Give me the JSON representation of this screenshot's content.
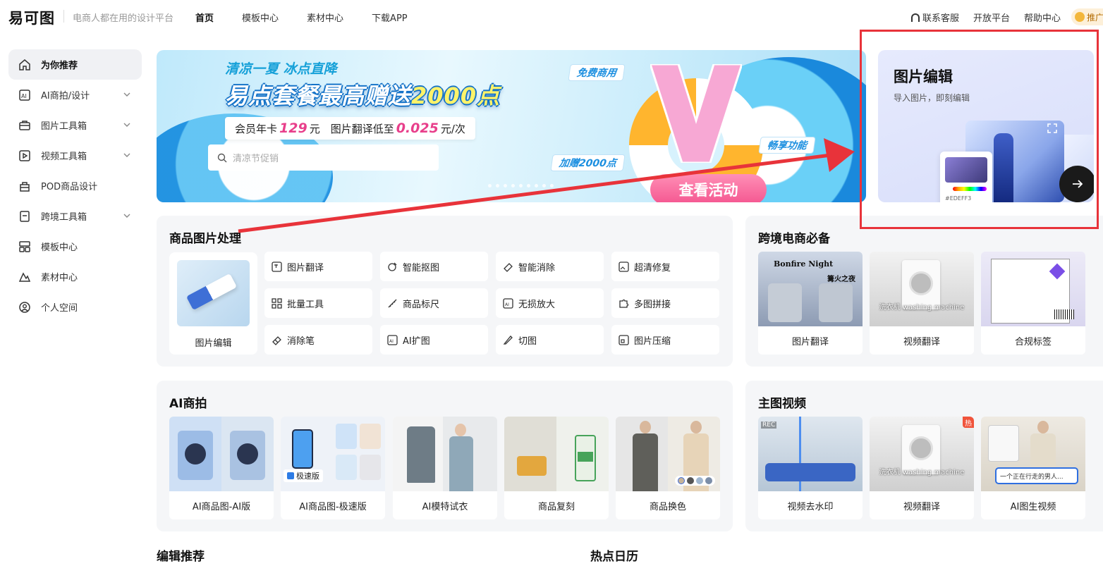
{
  "header": {
    "logo": "易可图",
    "tagline": "电商人都在用的设计平台",
    "nav": [
      "首页",
      "模板中心",
      "素材中心",
      "下载APP"
    ],
    "right_links": [
      "联系客服",
      "开放平台",
      "帮助中心"
    ],
    "promo": "推广"
  },
  "sidebar": {
    "items": [
      {
        "label": "为你推荐",
        "icon": "home-icon"
      },
      {
        "label": "AI商拍/设计",
        "icon": "ai-icon"
      },
      {
        "label": "图片工具箱",
        "icon": "toolbox-icon"
      },
      {
        "label": "视频工具箱",
        "icon": "video-icon"
      },
      {
        "label": "POD商品设计",
        "icon": "pod-icon"
      },
      {
        "label": "跨境工具箱",
        "icon": "crossborder-icon"
      },
      {
        "label": "模板中心",
        "icon": "template-icon"
      },
      {
        "label": "素材中心",
        "icon": "material-icon"
      },
      {
        "label": "个人空间",
        "icon": "user-icon"
      }
    ]
  },
  "banner": {
    "title1": "清凉一夏 冰点直降",
    "title2_a": "易点套餐最高赠送",
    "title2_b": "2000点",
    "sub_a": "会员年卡",
    "sub_price1": "129",
    "sub_b": "元　图片翻译低至",
    "sub_price2": "0.025",
    "sub_c": "元/次",
    "search_placeholder": "清凉节促销",
    "tag_free": "免费商用",
    "tag_bonus": "加赠2000点",
    "tag_enjoy": "畅享功能",
    "cta": "查看活动"
  },
  "feature": {
    "title": "图片编辑",
    "subtitle": "导入图片，即刻编辑",
    "hex": "#EDEFF3"
  },
  "product_image": {
    "title": "商品图片处理",
    "big_tile": "图片编辑",
    "tools": [
      "图片翻译",
      "智能抠图",
      "智能消除",
      "超清修复",
      "批量工具",
      "商品标尺",
      "无损放大",
      "多图拼接",
      "消除笔",
      "AI扩图",
      "切图",
      "图片压缩"
    ]
  },
  "crossborder": {
    "title": "跨境电商必备",
    "tiles": [
      "图片翻译",
      "视频翻译",
      "合规标签"
    ],
    "img_text_1": "Bonfire Night",
    "img_text_1b": "篝火之夜",
    "img_text_2": "洗衣机 washing machine"
  },
  "ai_shoot": {
    "title": "AI商拍",
    "tiles": [
      "AI商品图-AI版",
      "AI商品图-极速版",
      "AI模特试衣",
      "商品复刻",
      "商品换色"
    ],
    "fast_badge": "极速版"
  },
  "main_video": {
    "title": "主图视频",
    "tiles": [
      "视频去水印",
      "视频翻译",
      "AI图生视频"
    ],
    "rec": "REC",
    "hot": "热",
    "caption": "洗衣机 washing machine",
    "bubble": "一个正在行走的男人..."
  },
  "bottom": {
    "edit_recommend": "编辑推荐",
    "hot_calendar": "热点日历"
  }
}
